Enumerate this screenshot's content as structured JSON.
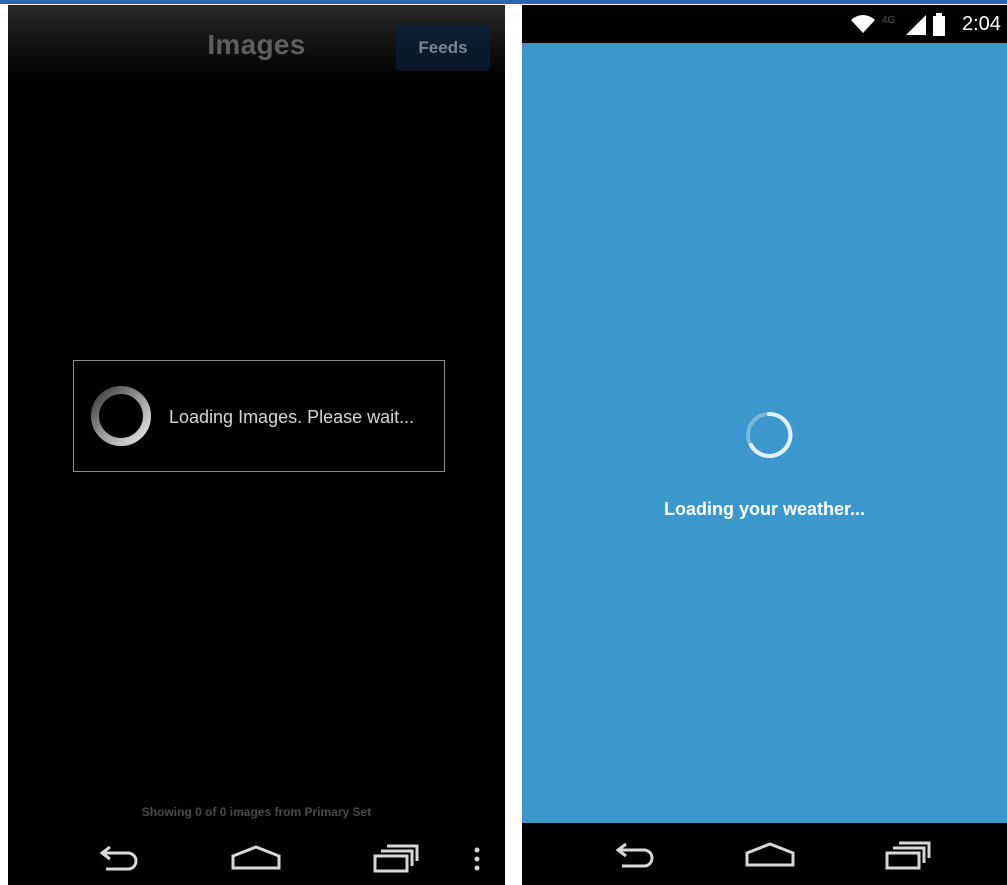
{
  "left_screen": {
    "title": "Images",
    "feeds_button": "Feeds",
    "loading_message": "Loading Images. Please wait...",
    "footer_status": "Showing 0 of 0 images from Primary Set",
    "nav_icons": [
      "back-icon",
      "home-icon",
      "recents-icon",
      "menu-icon"
    ]
  },
  "right_screen": {
    "status_bar": {
      "network": "4G",
      "time": "2:04",
      "icons": [
        "wifi-icon",
        "signal-icon",
        "battery-icon"
      ]
    },
    "loading_message": "Loading your weather...",
    "nav_icons": [
      "back-icon",
      "home-icon",
      "recents-icon"
    ]
  },
  "colors": {
    "weather_background": "#3b97cc",
    "left_background": "#000000",
    "feeds_button": "#0d2036",
    "frame_accent": "#2f64b4"
  }
}
